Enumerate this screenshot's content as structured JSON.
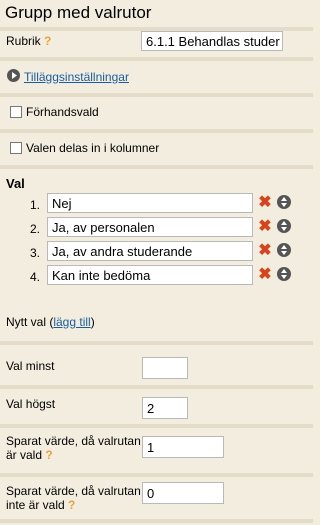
{
  "header": {
    "title": "Grupp med valrutor"
  },
  "rubrik": {
    "label": "Rubrik",
    "help": "?",
    "value": "6.1.1 Behandlas studer"
  },
  "extra_settings": {
    "label": "Tilläggsinställningar"
  },
  "preselected": {
    "label": "Förhandsvald"
  },
  "columns": {
    "label": "Valen delas in i kolumner"
  },
  "choices": {
    "heading": "Val",
    "items": [
      {
        "number": "1.",
        "value": "Nej"
      },
      {
        "number": "2.",
        "value": "Ja, av personalen"
      },
      {
        "number": "3.",
        "value": "Ja, av andra studerande"
      },
      {
        "number": "4.",
        "value": "Kan inte bedöma"
      }
    ],
    "new_choice_prefix": "Nytt val (",
    "new_choice_link": "lägg till",
    "new_choice_suffix": ")"
  },
  "min_choices": {
    "label": "Val minst",
    "value": ""
  },
  "max_choices": {
    "label": "Val högst",
    "value": "2"
  },
  "checked_value": {
    "label_line1": "Sparat värde, då valrutan",
    "label_line2": "är vald",
    "help": "?",
    "value": "1"
  },
  "unchecked_value": {
    "label_line1": "Sparat värde, då valrutan",
    "label_line2": "inte är vald",
    "help": "?",
    "value": "0"
  }
}
